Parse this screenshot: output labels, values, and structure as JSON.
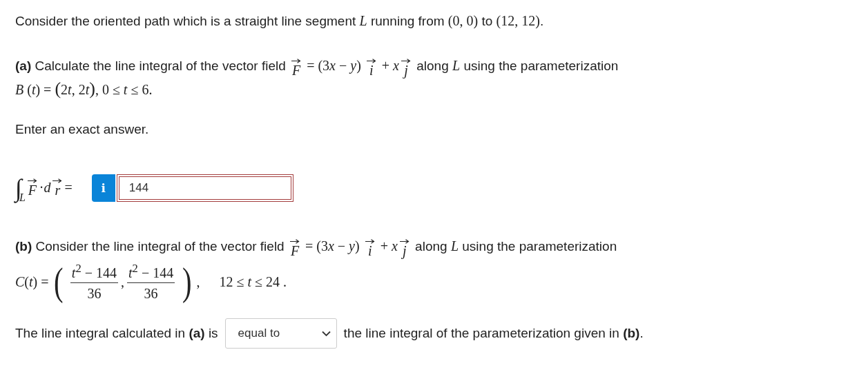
{
  "intro": [
    {
      "kind": "text",
      "text": "Consider the oriented path which is a straight line segment "
    },
    {
      "kind": "var",
      "text": "L"
    },
    {
      "kind": "text",
      "text": " running from "
    },
    {
      "kind": "math",
      "text": "(0, 0)"
    },
    {
      "kind": "text",
      "text": " to "
    },
    {
      "kind": "math",
      "text": "(12, 12)"
    },
    {
      "kind": "text",
      "text": "."
    }
  ],
  "part_a": [
    {
      "kind": "text",
      "text": "**(a)** Calculate the line integral of the vector field "
    },
    {
      "kind": "vec",
      "text": "F"
    },
    {
      "kind": "math",
      "text": " = (3"
    },
    {
      "kind": "var",
      "text": "x"
    },
    {
      "kind": "math",
      "text": " − "
    },
    {
      "kind": "var",
      "text": "y"
    },
    {
      "kind": "math",
      "text": ") "
    },
    {
      "kind": "vec",
      "text": "i"
    },
    {
      "kind": "math",
      "text": " + "
    },
    {
      "kind": "var",
      "text": "x"
    },
    {
      "kind": "vec",
      "text": "j"
    },
    {
      "kind": "text",
      "text": " along "
    },
    {
      "kind": "var",
      "text": "L"
    },
    {
      "kind": "text",
      "text": " using the parameterization"
    },
    {
      "kind": "break"
    },
    {
      "kind": "var",
      "text": "B"
    },
    {
      "kind": "math",
      "text": " ("
    },
    {
      "kind": "var",
      "text": "t"
    },
    {
      "kind": "math",
      "text": ") = "
    },
    {
      "kind": "paren",
      "text": "("
    },
    {
      "kind": "math",
      "text": "2"
    },
    {
      "kind": "var",
      "text": "t"
    },
    {
      "kind": "math",
      "text": ", 2"
    },
    {
      "kind": "var",
      "text": "t"
    },
    {
      "kind": "paren",
      "text": ")"
    },
    {
      "kind": "math",
      "text": ", 0 ≤ "
    },
    {
      "kind": "var",
      "text": "t"
    },
    {
      "kind": "math",
      "text": " ≤ 6."
    }
  ],
  "instruction": "Enter an exact answer.",
  "integral": [
    {
      "kind": "integral",
      "text": "∫",
      "sub": "L"
    },
    {
      "kind": "vec",
      "text": "F"
    },
    {
      "kind": "math",
      "text": " · "
    },
    {
      "kind": "var",
      "text": "d"
    },
    {
      "kind": "vec",
      "text": "r"
    },
    {
      "kind": "math",
      "text": " ="
    }
  ],
  "answer": {
    "info": "i",
    "value": "144",
    "incorrect": true
  },
  "part_b": [
    {
      "kind": "text",
      "text": "**(b)** Consider the line integral of the vector field "
    },
    {
      "kind": "vec",
      "text": "F"
    },
    {
      "kind": "math",
      "text": " = (3"
    },
    {
      "kind": "var",
      "text": "x"
    },
    {
      "kind": "math",
      "text": " − "
    },
    {
      "kind": "var",
      "text": "y"
    },
    {
      "kind": "math",
      "text": ") "
    },
    {
      "kind": "vec",
      "text": "i"
    },
    {
      "kind": "math",
      "text": " + "
    },
    {
      "kind": "var",
      "text": "x"
    },
    {
      "kind": "vec",
      "text": "j"
    },
    {
      "kind": "text",
      "text": " along "
    },
    {
      "kind": "var",
      "text": "L"
    },
    {
      "kind": "text",
      "text": " using the parameterization"
    }
  ],
  "formula_b": [
    {
      "kind": "var",
      "text": "C"
    },
    {
      "kind": "math",
      "text": "("
    },
    {
      "kind": "var",
      "text": "t"
    },
    {
      "kind": "math",
      "text": ") ="
    },
    {
      "kind": "bigparen",
      "text": "("
    },
    {
      "kind": "frac",
      "num": "*t*$^{2}$ − 144",
      "den": "36"
    },
    {
      "kind": "math",
      "text": ","
    },
    {
      "kind": "frac",
      "num": "*t*$^{2}$ − 144",
      "den": "36"
    },
    {
      "kind": "bigparen",
      "text": ")"
    },
    {
      "kind": "math",
      "text": ","
    },
    {
      "kind": "spaced",
      "text": "12 ≤ *t* ≤ 24 ."
    }
  ],
  "comparison": {
    "before": "The line integral calculated in **(a)** is",
    "choice": "equal to",
    "after": "the line integral of the parameterization given in **(b)**."
  }
}
